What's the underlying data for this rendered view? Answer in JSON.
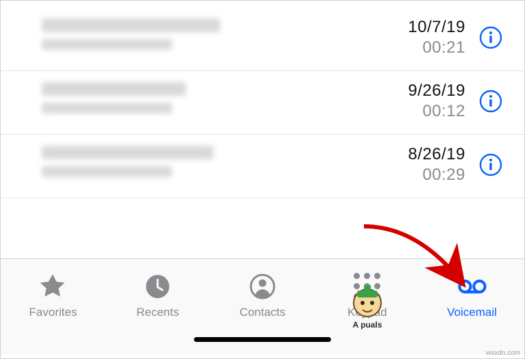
{
  "voicemails": [
    {
      "date": "10/7/19",
      "duration": "00:21"
    },
    {
      "date": "9/26/19",
      "duration": "00:12"
    },
    {
      "date": "8/26/19",
      "duration": "00:29"
    }
  ],
  "tabs": {
    "favorites": "Favorites",
    "recents": "Recents",
    "contacts": "Contacts",
    "keypad": "Keypad",
    "voicemail": "Voicemail",
    "active": "voicemail"
  },
  "colors": {
    "accent_blue": "#0a63ff",
    "inactive_gray": "#8a8a8f",
    "separator": "#e4e4e6"
  },
  "annotation_arrow_color": "#d40000",
  "mascot_brand": "Appuals",
  "watermark": "wsxdn.com"
}
